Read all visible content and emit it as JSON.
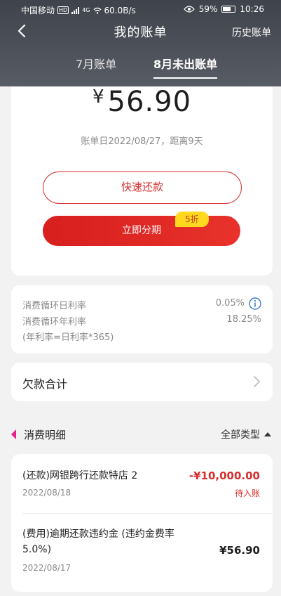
{
  "status_bar": {
    "carrier": "中国移动",
    "hd": "HD",
    "net": "4G",
    "speed": "60.0B/s",
    "battery": "59%",
    "time": "10:26"
  },
  "nav": {
    "title": "我的账单",
    "history": "历史账单"
  },
  "tabs": [
    {
      "label": "7月账单",
      "active": false
    },
    {
      "label": "8月未出账单",
      "active": true
    }
  ],
  "summary": {
    "currency": "¥",
    "amount": "56.90",
    "bill_date_text": "账单日2022/08/27，距离9天",
    "quick_repay_label": "快速还款",
    "installment_label": "立即分期",
    "discount_badge": "5折"
  },
  "rates": {
    "daily_label": "消费循环日利率",
    "daily_value": "0.05%",
    "annual_label": "消费循环年利率",
    "annual_value": "18.25%",
    "formula": "(年利率=日利率*365)"
  },
  "debt": {
    "label": "欠款合计"
  },
  "details": {
    "title": "消费明细",
    "filter_label": "全部类型",
    "transactions": [
      {
        "name": "(还款)网银跨行还款特店 2",
        "date": "2022/08/18",
        "amount": "-¥10,000.00",
        "status": "待入账"
      },
      {
        "name": "(费用)逾期还款违约金 (违约金费率 5.0%)",
        "date": "2022/08/17",
        "amount": "¥56.90",
        "status": ""
      }
    ]
  },
  "colors": {
    "accent": "#d6302e",
    "header_bg": "#4a4e56",
    "badge": "#ffd81f",
    "detail_marker": "#e91e8c"
  }
}
